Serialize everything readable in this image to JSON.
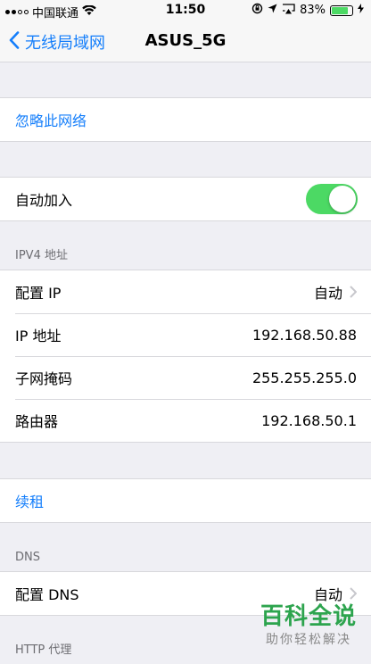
{
  "status_bar": {
    "carrier": "中国联通",
    "time": "11:50",
    "battery_pct": "83%",
    "signal_bars_filled": 2,
    "icons": [
      "wifi-icon",
      "orientation-lock-icon",
      "location-icon",
      "airplay-icon",
      "battery-icon",
      "charging-icon"
    ]
  },
  "nav": {
    "back_label": "无线局域网",
    "title": "ASUS_5G"
  },
  "forget": {
    "label": "忽略此网络"
  },
  "auto_join": {
    "label": "自动加入",
    "enabled": true
  },
  "ipv4": {
    "header": "IPV4 地址",
    "rows": [
      {
        "label": "配置 IP",
        "value": "自动"
      },
      {
        "label": "IP 地址",
        "value": "192.168.50.88"
      },
      {
        "label": "子网掩码",
        "value": "255.255.255.0"
      },
      {
        "label": "路由器",
        "value": "192.168.50.1"
      }
    ]
  },
  "renew": {
    "label": "续租"
  },
  "dns": {
    "header": "DNS",
    "configure_label": "配置 DNS",
    "configure_value": "自动"
  },
  "http_proxy": {
    "header": "HTTP 代理"
  },
  "watermark": {
    "main": "百科全说",
    "sub": "助你轻松解决"
  },
  "colors": {
    "accent": "#147efb",
    "toggle_on": "#4cd964",
    "background": "#efeff4",
    "watermark": "#2da44e"
  }
}
